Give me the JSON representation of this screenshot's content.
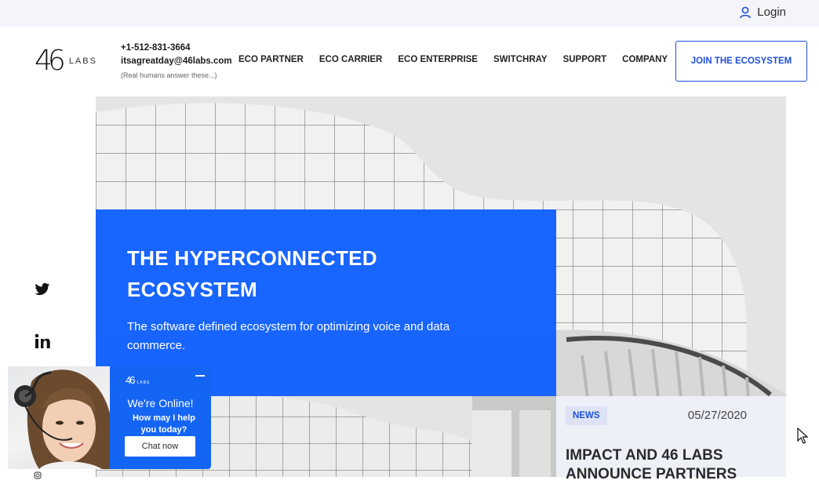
{
  "topbar": {
    "login_label": "Login",
    "login_icon": "user-icon"
  },
  "brand": {
    "logo_mark": "46",
    "logo_text": "LABS"
  },
  "contact": {
    "phone": "+1-512-831-3664",
    "email": "itsagreatday@46labs.com",
    "note": "(Real humans answer these...)"
  },
  "nav": {
    "items": [
      {
        "label": "ECO PARTNER"
      },
      {
        "label": "ECO CARRIER"
      },
      {
        "label": "ECO ENTERPRISE"
      },
      {
        "label": "SWITCHRAY"
      },
      {
        "label": "SUPPORT"
      },
      {
        "label": "COMPANY"
      }
    ],
    "cta_label": "JOIN THE ECOSYSTEM"
  },
  "hero": {
    "title_line1": "THE HYPERCONNECTED",
    "title_line2": "ECOSYSTEM",
    "subtitle": "The software defined ecosystem for optimizing voice and data commerce."
  },
  "news": {
    "badge": "NEWS",
    "date": "05/27/2020",
    "title": "IMPACT AND 46 LABS ANNOUNCE PARTNERS"
  },
  "social": {
    "icons": [
      "twitter-icon",
      "linkedin-icon",
      "instagram-icon"
    ]
  },
  "chat": {
    "logo_mark": "46",
    "logo_text": "LABS",
    "status": "We're Online!",
    "prompt": "How may I help you today?",
    "button_label": "Chat now"
  },
  "colors": {
    "brand_blue": "#1565f5",
    "cta_blue": "#1f4fd8",
    "topbar_bg": "#f4f5fb",
    "news_bg": "#eef0f8"
  }
}
